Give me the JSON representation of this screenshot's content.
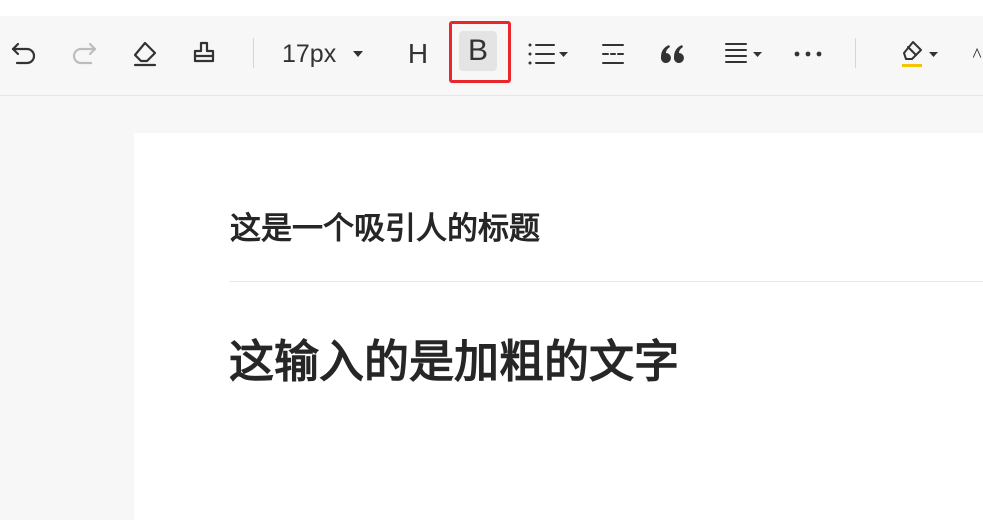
{
  "toolbar": {
    "font_size": "17px",
    "heading_label": "H",
    "bold_label": "B",
    "more_label": "···"
  },
  "document": {
    "title": "这是一个吸引人的标题",
    "body_text": "这输入的是加粗的文字"
  },
  "colors": {
    "highlight_frame": "#e8262c",
    "highlighter_underline": "#f5c400"
  }
}
